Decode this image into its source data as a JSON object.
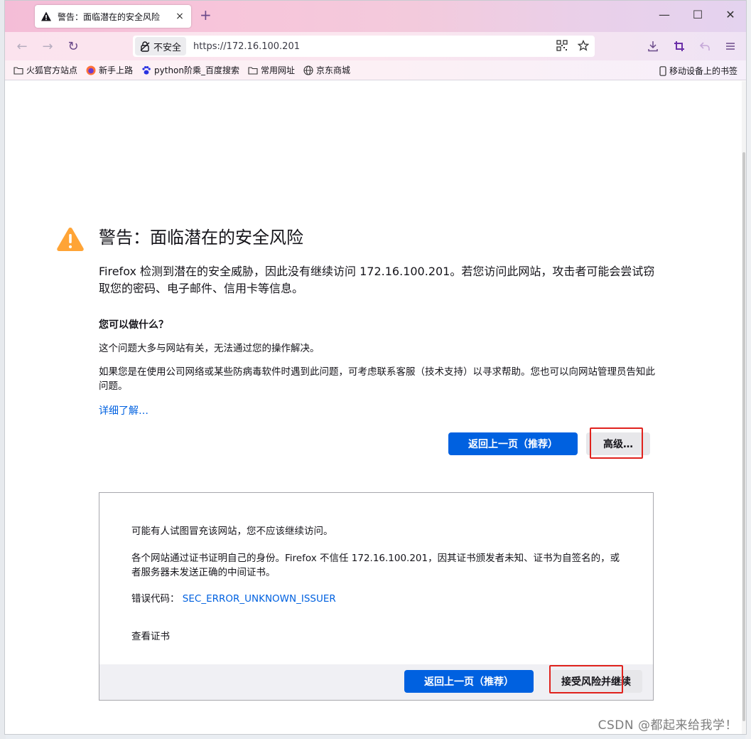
{
  "tab": {
    "title": "警告：面临潜在的安全风险",
    "close": "×"
  },
  "newtab": "+",
  "window_controls": {
    "minimize": "—",
    "maximize": "☐",
    "close": "✕"
  },
  "nav": {
    "back": "←",
    "forward": "→",
    "reload": "↻",
    "insecure_label": "不安全",
    "url": "https://172.16.100.201"
  },
  "bookmarks": [
    {
      "label": "火狐官方站点",
      "icon": "folder-icon"
    },
    {
      "label": "新手上路",
      "icon": "firefox-icon"
    },
    {
      "label": "python阶乘_百度搜索",
      "icon": "paw-icon"
    },
    {
      "label": "常用网址",
      "icon": "folder-icon"
    },
    {
      "label": "京东商城",
      "icon": "globe-icon"
    }
  ],
  "mobile_bookmarks": "移动设备上的书签",
  "page": {
    "title": "警告：面临潜在的安全风险",
    "intro": "Firefox 检测到潜在的安全威胁，因此没有继续访问 172.16.100.201。若您访问此网站，攻击者可能会尝试窃取您的密码、电子邮件、信用卡等信息。",
    "what_can_do": "您可以做什么？",
    "para1": "这个问题大多与网站有关，无法通过您的操作解决。",
    "para2": "如果您是在使用公司网络或某些防病毒软件时遇到此问题，可考虑联系客服（技术支持）以寻求帮助。您也可以向网站管理员告知此问题。",
    "learn_more": "详细了解…",
    "go_back": "返回上一页（推荐）",
    "advanced": "高级…"
  },
  "advanced_panel": {
    "line1": "可能有人试图冒充该网站，您不应该继续访问。",
    "line2": "各个网站通过证书证明自己的身份。Firefox 不信任 172.16.100.201，因其证书颁发者未知、证书为自签名的，或者服务器未发送正确的中间证书。",
    "error_label": "错误代码：",
    "error_code": "SEC_ERROR_UNKNOWN_ISSUER",
    "view_cert": "查看证书",
    "go_back": "返回上一页（推荐）",
    "accept": "接受风险并继续"
  },
  "watermark": "CSDN @都起来给我学！",
  "colors": {
    "primary": "#0061e0",
    "warning": "#ffa436",
    "highlight": "#e0221d"
  }
}
